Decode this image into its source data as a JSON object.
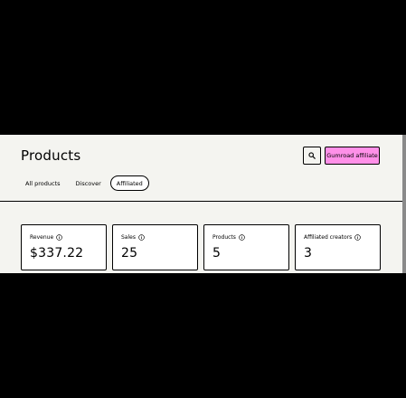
{
  "page": {
    "title": "Products"
  },
  "header": {
    "search_icon": "search-icon",
    "affiliate_button_label": "Gumroad affiliate"
  },
  "tabs": [
    {
      "label": "All products",
      "active": false
    },
    {
      "label": "Discover",
      "active": false
    },
    {
      "label": "Affiliated",
      "active": true
    }
  ],
  "stats": [
    {
      "label": "Revenue",
      "value": "$337.22"
    },
    {
      "label": "Sales",
      "value": "25"
    },
    {
      "label": "Products",
      "value": "5"
    },
    {
      "label": "Affiliated creators",
      "value": "3"
    }
  ],
  "colors": {
    "background": "#f4f4f0",
    "accent_pink": "#ff90e8",
    "border": "#000000"
  }
}
